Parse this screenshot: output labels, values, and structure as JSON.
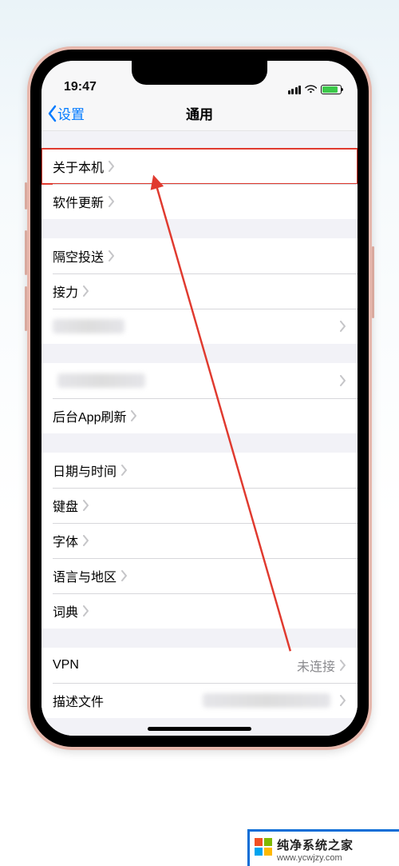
{
  "statusbar": {
    "time": "19:47"
  },
  "nav": {
    "back": "设置",
    "title": "通用"
  },
  "group1": {
    "about": {
      "label": "关于本机"
    },
    "update": {
      "label": "软件更新"
    }
  },
  "group2": {
    "airdrop": {
      "label": "隔空投送"
    },
    "handoff": {
      "label": "接力"
    }
  },
  "group3": {
    "bgrefresh": {
      "label": "后台App刷新"
    }
  },
  "group4": {
    "datetime": {
      "label": "日期与时间"
    },
    "keyboard": {
      "label": "键盘"
    },
    "fonts": {
      "label": "字体"
    },
    "lang": {
      "label": "语言与地区"
    },
    "dict": {
      "label": "词典"
    }
  },
  "group5": {
    "vpn": {
      "label": "VPN",
      "value": "未连接"
    },
    "profiles": {
      "label": "描述文件"
    }
  },
  "watermark": {
    "title": "纯净系统之家",
    "url": "www.ycwjzy.com"
  },
  "colors": {
    "accent": "#007aff",
    "highlight": "#e03a2f"
  }
}
